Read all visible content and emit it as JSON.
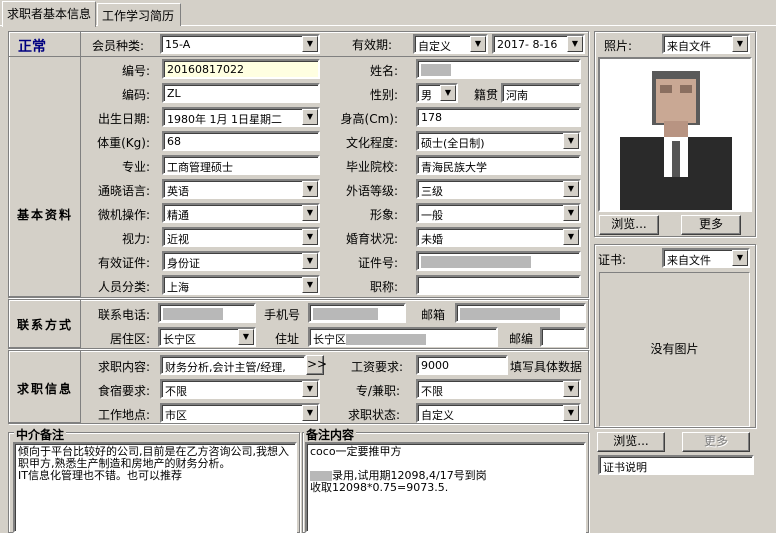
{
  "tabs": [
    "求职者基本信息",
    "工作学习简历"
  ],
  "status": "正常",
  "member_type": {
    "label": "会员种类:",
    "value": "15-A"
  },
  "validity": {
    "label": "有效期:",
    "mode": "自定义",
    "date": "2017- 8-16"
  },
  "photo": {
    "label": "照片:",
    "source": "来自文件",
    "browse": "浏览...",
    "more": "更多"
  },
  "cert": {
    "label": "证书:",
    "source": "来自文件",
    "no_image": "没有图片",
    "browse": "浏览...",
    "more": "更多",
    "desc": "证书说明"
  },
  "sections": {
    "basic": "基本资料",
    "contact": "联系方式",
    "job": "求职信息"
  },
  "fields": {
    "number": {
      "label": "编号:",
      "value": "20160817022"
    },
    "name": {
      "label": "姓名:",
      "value": ""
    },
    "code": {
      "label": "编码:",
      "value": "ZL"
    },
    "gender": {
      "label": "性别:",
      "value": "男"
    },
    "native": {
      "label": "籍贯",
      "value": "河南"
    },
    "birth": {
      "label": "出生日期:",
      "value": "1980年 1月 1日星期二"
    },
    "height": {
      "label": "身高(Cm):",
      "value": "178"
    },
    "weight": {
      "label": "体重(Kg):",
      "value": "68"
    },
    "education": {
      "label": "文化程度:",
      "value": "硕士(全日制)"
    },
    "major": {
      "label": "专业:",
      "value": "工商管理硕士"
    },
    "school": {
      "label": "毕业院校:",
      "value": "青海民族大学"
    },
    "language": {
      "label": "通晓语言:",
      "value": "英语"
    },
    "lang_level": {
      "label": "外语等级:",
      "value": "三级"
    },
    "computer": {
      "label": "微机操作:",
      "value": "精通"
    },
    "image": {
      "label": "形象:",
      "value": "一般"
    },
    "vision": {
      "label": "视力:",
      "value": "近视"
    },
    "marital": {
      "label": "婚育状况:",
      "value": "未婚"
    },
    "id_type": {
      "label": "有效证件:",
      "value": "身份证"
    },
    "id_no": {
      "label": "证件号:",
      "value": ""
    },
    "category": {
      "label": "人员分类:",
      "value": "上海"
    },
    "title": {
      "label": "职称:",
      "value": ""
    }
  },
  "contact": {
    "phone": {
      "label": "联系电话:"
    },
    "mobile": {
      "label": "手机号"
    },
    "email": {
      "label": "邮箱"
    },
    "district": {
      "label": "居住区:",
      "value": "长宁区"
    },
    "address": {
      "label": "住址",
      "value": "长宁区"
    },
    "zip": {
      "label": "邮编"
    }
  },
  "job": {
    "content": {
      "label": "求职内容:",
      "value": "财务分析,会计主管/经理,",
      "more": ">>"
    },
    "salary": {
      "label": "工资要求:",
      "value": "9000",
      "hint": "填写具体数据"
    },
    "board": {
      "label": "食宿要求:",
      "value": "不限"
    },
    "parttime": {
      "label": "专/兼职:",
      "value": "不限"
    },
    "location": {
      "label": "工作地点:",
      "value": "市区"
    },
    "state": {
      "label": "求职状态:",
      "value": "自定义"
    }
  },
  "memo_agent": {
    "title": "中介备注",
    "text": "倾向于平台比较好的公司,目前是在乙方咨询公司,我想入职甲方,熟悉生产制造和房地产的财务分析。\nIT信息化管理也不错。也可以推荐"
  },
  "memo_note": {
    "title": "备注内容",
    "line1": "coco一定要推甲方",
    "line2": "录用,试用期12098,4/17号到岗",
    "line3": "收取12098*0.75=9073.5."
  }
}
